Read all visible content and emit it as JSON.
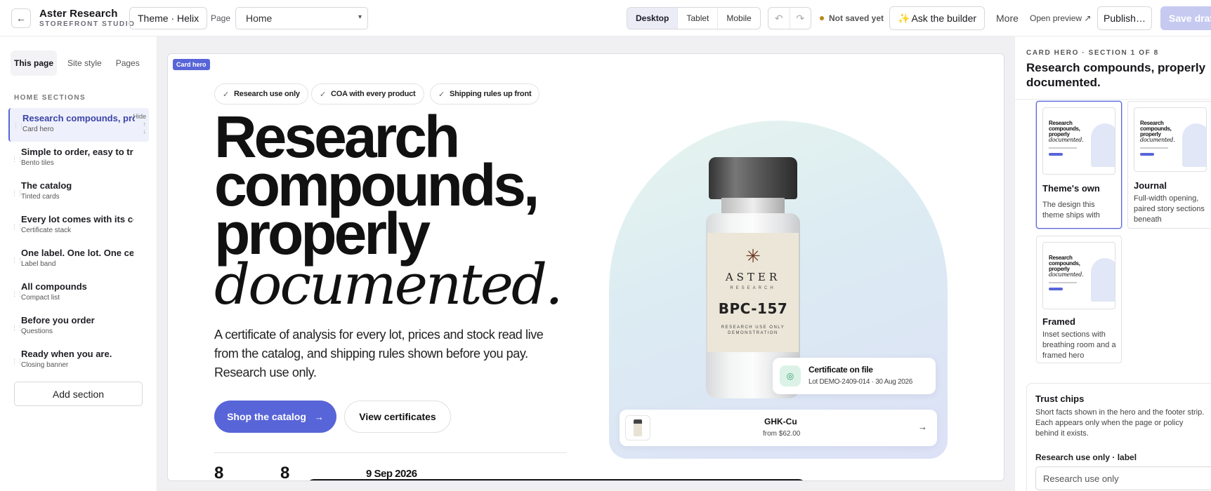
{
  "topbar": {
    "brand_name": "Aster Research",
    "brand_sub": "STOREFRONT STUDIO",
    "theme_label": "Theme · Helix",
    "page_label": "Page",
    "page_value": "Home",
    "devices": [
      "Desktop",
      "Tablet",
      "Mobile"
    ],
    "active_device": "Desktop",
    "status": "Not saved yet",
    "ask_label": "Ask the builder",
    "more_label": "More",
    "open_preview_label": "Open preview ↗",
    "publish_label": "Publish…",
    "save_label": "Save draft",
    "status_color": "#b58a19",
    "accent": "#5865d8"
  },
  "sidebar": {
    "tabs": [
      "This page",
      "Site style",
      "Pages"
    ],
    "heading": "HOME SECTIONS",
    "hide_label": "Hide",
    "sections": [
      {
        "title": "Research compounds, properly documented.",
        "type": "Card hero"
      },
      {
        "title": "Simple to order, easy to trust.",
        "type": "Bento tiles"
      },
      {
        "title": "The catalog",
        "type": "Tinted cards"
      },
      {
        "title": "Every lot comes with its certificate",
        "type": "Certificate stack"
      },
      {
        "title": "One label. One lot. One certificate.",
        "type": "Label band"
      },
      {
        "title": "All compounds",
        "type": "Compact list"
      },
      {
        "title": "Before you order",
        "type": "Questions"
      },
      {
        "title": "Ready when you are.",
        "type": "Closing banner"
      }
    ],
    "add_section_label": "Add section"
  },
  "canvas": {
    "section_tag": "Card hero",
    "chips": [
      "Research use only",
      "COA with every product",
      "Shipping rules up front"
    ],
    "headline_lines": [
      "Research",
      "compounds,",
      "properly"
    ],
    "headline_italic": "documented.",
    "lede": "A certificate of analysis for every lot, prices and stock read live from the catalog, and shipping rules shown before you pay. Research use only.",
    "primary_cta": "Shop the catalog",
    "secondary_cta": "View certificates",
    "stat_1": "8",
    "stat_2": "8",
    "stat_date": "9 Sep 2026",
    "vial": {
      "brand": "ASTER",
      "brand_sub": "RESEARCH",
      "code": "BPC-157",
      "ruo": "RESEARCH USE ONLY",
      "demo": "DEMONSTRATION"
    },
    "coa_card": {
      "title": "Certificate on file",
      "detail": "Lot DEMO-2409-014 · 30 Aug 2026"
    },
    "product_card": {
      "name": "GHK-Cu",
      "price": "from $62.00"
    }
  },
  "right_panel": {
    "kicker": "CARD HERO · SECTION 1 OF 8",
    "title": "Research compounds, properly documented.",
    "layouts": [
      {
        "name": "Theme's own",
        "desc": "The design this theme ships with",
        "selected": true
      },
      {
        "name": "Journal",
        "desc": "Full-width opening, paired story sections beneath",
        "selected": false
      },
      {
        "name": "Framed",
        "desc": "Inset sections with breathing room and a framed hero",
        "selected": false
      }
    ],
    "trust": {
      "title": "Trust chips",
      "desc": "Short facts shown in the hero and the footer strip. Each appears only when the page or policy behind it exists.",
      "field_label": "Research use only · label",
      "field_value": "Research use only"
    }
  }
}
